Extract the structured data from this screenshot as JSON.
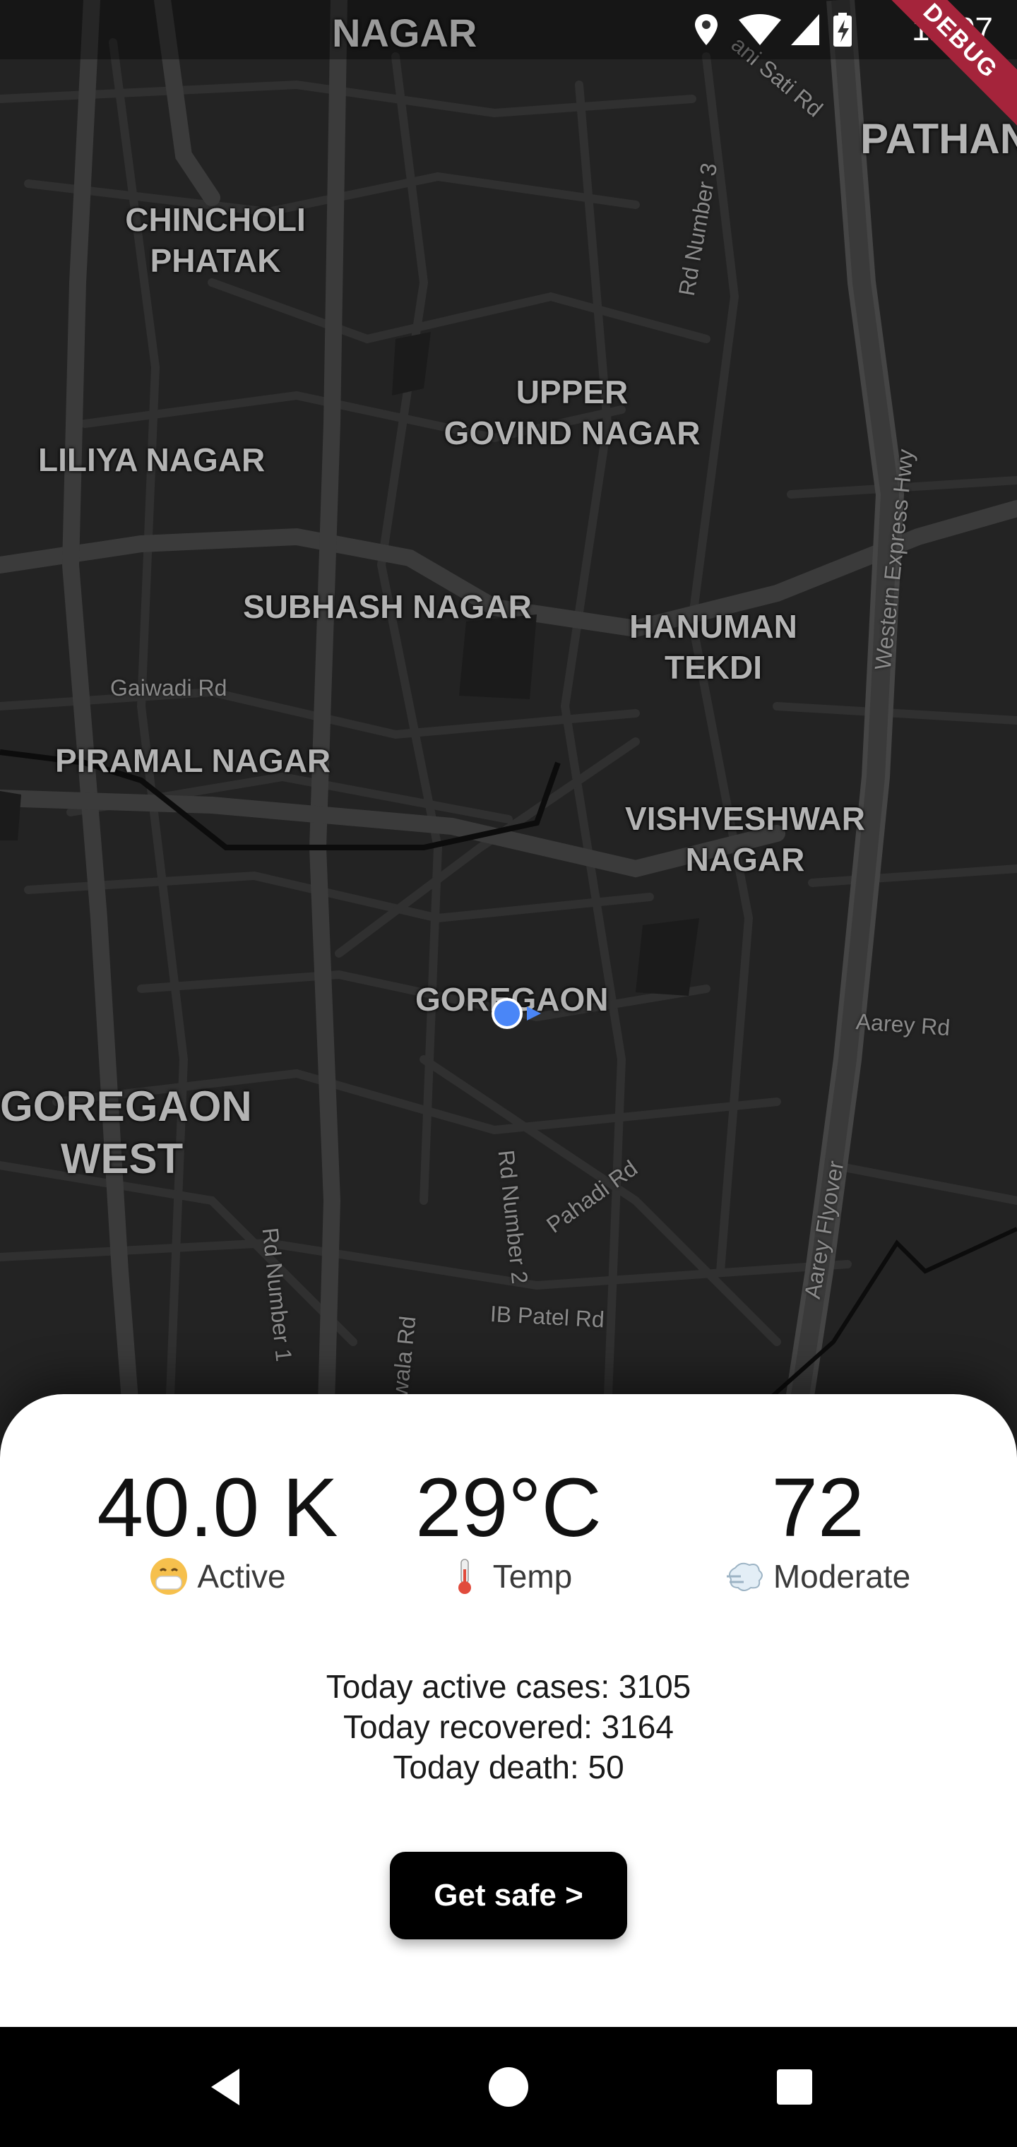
{
  "status_bar": {
    "time": "12:07",
    "icons": [
      "location-icon",
      "wifi-icon",
      "signal-icon",
      "battery-icon"
    ]
  },
  "debug_banner": "DEBUG",
  "map": {
    "area_labels": [
      {
        "id": "nagar-top",
        "text": "NAGAR"
      },
      {
        "id": "pathan",
        "text": "PATHAN"
      },
      {
        "id": "chincholi",
        "text": "CHINCHOLI\nPHATAK"
      },
      {
        "id": "upper-govind",
        "text": "UPPER\nGOVIND NAGAR"
      },
      {
        "id": "liliya",
        "text": "LILIYA NAGAR"
      },
      {
        "id": "subhash",
        "text": "SUBHASH NAGAR"
      },
      {
        "id": "hanuman",
        "text": "HANUMAN\nTEKDI"
      },
      {
        "id": "piramal",
        "text": "PIRAMAL NAGAR"
      },
      {
        "id": "vishveshwar",
        "text": "VISHVESHWAR\nNAGAR"
      },
      {
        "id": "goregaon",
        "text": "GOREGAON"
      },
      {
        "id": "goregaon-west",
        "text": "GOREGAON\nWEST"
      }
    ],
    "road_labels": [
      {
        "id": "sati-rd",
        "text": "ani Sati Rd"
      },
      {
        "id": "rd-number-3",
        "text": "Rd Number 3"
      },
      {
        "id": "western-express",
        "text": "Western Express Hwy"
      },
      {
        "id": "gaiwadi",
        "text": "Gaiwadi Rd"
      },
      {
        "id": "aarey-rd",
        "text": "Aarey Rd"
      },
      {
        "id": "rd-number-2",
        "text": "Rd Number 2"
      },
      {
        "id": "pahadi",
        "text": "Pahadi Rd"
      },
      {
        "id": "aarey-flyover",
        "text": "Aarey Flyover"
      },
      {
        "id": "rd-number-1",
        "text": "Rd Number 1"
      },
      {
        "id": "wala-rd",
        "text": "wala Rd"
      },
      {
        "id": "ib-patel",
        "text": "IB Patel Rd"
      }
    ],
    "marker": {
      "icon": "current-location-icon",
      "color": "#4a86f7"
    }
  },
  "stats": {
    "active": {
      "value": "40.0 K",
      "label": "Active",
      "icon": "face-mask-icon"
    },
    "temp": {
      "value": "29°C",
      "label": "Temp",
      "icon": "thermometer-icon"
    },
    "air": {
      "value": "72",
      "label": "Moderate",
      "icon": "wind-icon"
    }
  },
  "today": {
    "active": "Today active cases: 3105",
    "recovered": "Today recovered: 3164",
    "death": "Today death: 50"
  },
  "button": {
    "label": "Get safe >"
  },
  "navigation": {
    "icons": [
      "back-icon",
      "home-icon",
      "recents-icon"
    ]
  }
}
